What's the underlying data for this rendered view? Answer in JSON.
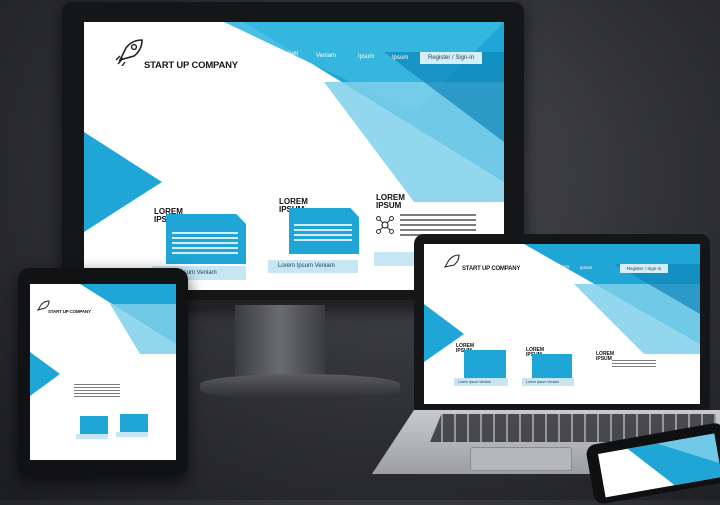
{
  "scene": {
    "devices": [
      "desktop-monitor",
      "laptop",
      "tablet",
      "phone"
    ]
  },
  "site": {
    "brand": "START UP COMPANY",
    "nav": [
      "Lorem",
      "Ipsum",
      "Veniam",
      "Ipsum",
      "Ipsum"
    ],
    "cta": "Register / Sign-in",
    "cards": [
      {
        "title": "LOREM IPSUM",
        "footer": "Lorem Ipsum Veniam"
      },
      {
        "title": "LOREM IPSUM",
        "footer": "Lorem Ipsum Veniam"
      },
      {
        "title": "LOREM IPSUM",
        "footer": ""
      }
    ],
    "laptop_nav": [
      "Lorem",
      "Ipsum",
      "Veniam",
      "Ipsum"
    ],
    "laptop_cta": "Register / Sign-in",
    "laptop_card_footer": "Lorem Ipsum Veniam",
    "tablet_brand": "START UP COMPANY"
  },
  "colors": {
    "accent": "#1fa6d6",
    "accent_light": "#7fd0ea",
    "accent_dark": "#0f86b8"
  },
  "icons": [
    "rocket-icon",
    "network-icon"
  ]
}
